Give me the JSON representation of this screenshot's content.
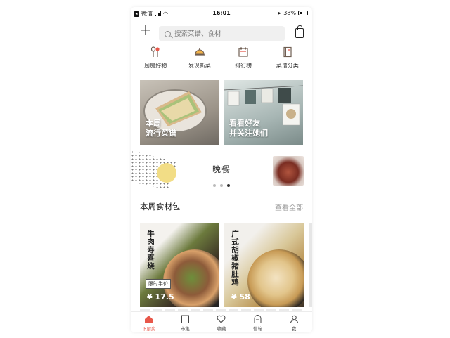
{
  "status_bar": {
    "carrier": "微信",
    "time": "16:01",
    "battery": "38%"
  },
  "search": {
    "placeholder": "搜索菜谱、食材"
  },
  "categories": [
    {
      "label": "厨房好物",
      "icon": "kitchen-tools-icon"
    },
    {
      "label": "发现新菜",
      "icon": "cloche-dish-icon"
    },
    {
      "label": "排行榜",
      "icon": "ranking-board-icon"
    },
    {
      "label": "菜谱分类",
      "icon": "recipe-book-icon"
    }
  ],
  "banners": [
    {
      "line1": "本周",
      "line2": "流行菜谱"
    },
    {
      "line1": "看看好友",
      "line2": "并关注她们"
    }
  ],
  "meal": {
    "title": "一 晚餐 一",
    "pages": 3,
    "active_page": 3
  },
  "section": {
    "title": "本周食材包",
    "more": "查看全部"
  },
  "products": [
    {
      "title": "牛肉寿喜烧",
      "tag": "限时半价",
      "price": "¥ 17.5"
    },
    {
      "title": "广式胡椒猪肚鸡",
      "price": "¥ 58"
    }
  ],
  "tabs": [
    {
      "label": "下厨房",
      "icon": "home-icon",
      "active": true
    },
    {
      "label": "市集",
      "icon": "market-icon",
      "active": false
    },
    {
      "label": "收藏",
      "icon": "heart-icon",
      "active": false
    },
    {
      "label": "信箱",
      "icon": "mailbox-icon",
      "active": false
    },
    {
      "label": "我",
      "icon": "profile-icon",
      "active": false
    }
  ],
  "colors": {
    "accent": "#e8574a",
    "moon": "#f2dd86"
  }
}
